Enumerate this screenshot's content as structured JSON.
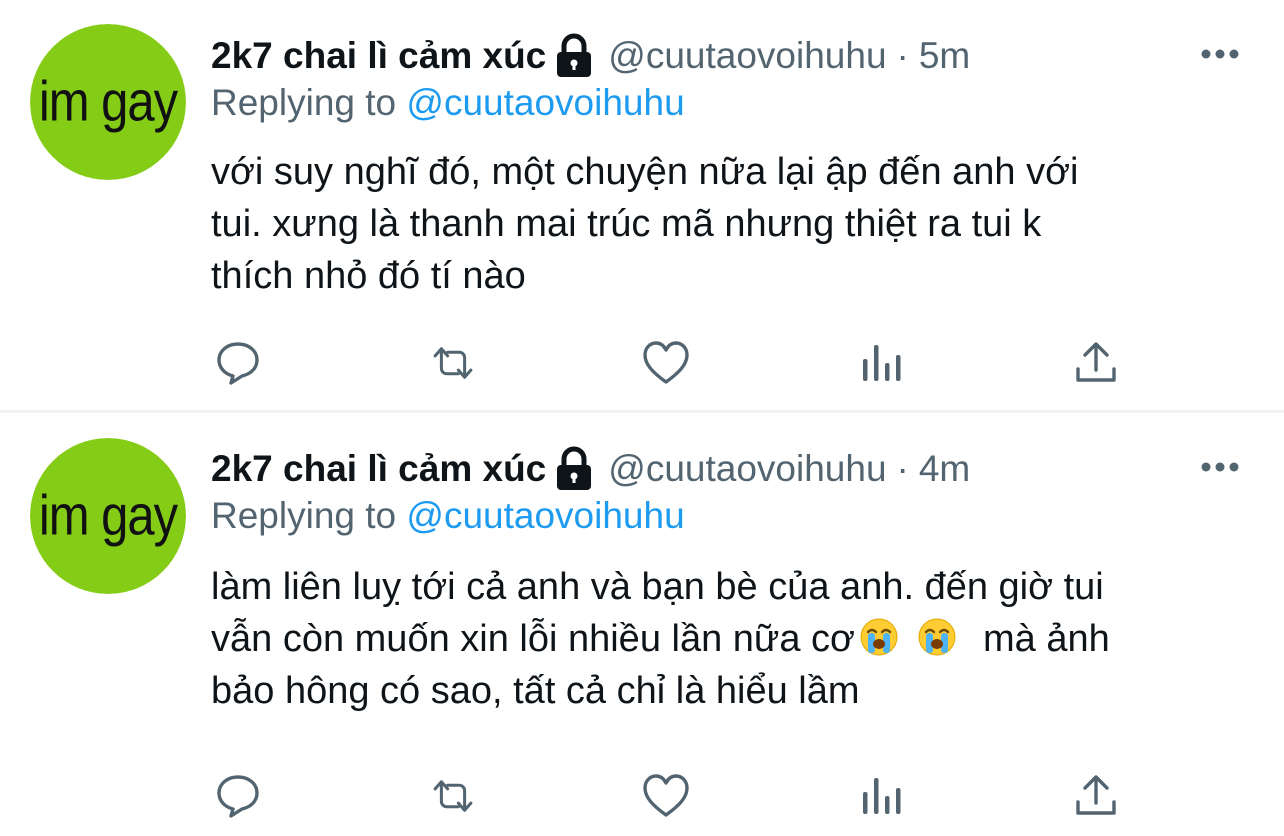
{
  "tweets": [
    {
      "avatar_text": "im gay",
      "display_name": "2k7 chai lì cảm xúc",
      "handle": "@cuutaovoihuhu",
      "separator": "·",
      "time": "5m",
      "replying_prefix": "Replying to",
      "replying_to": "@cuutaovoihuhu",
      "body_lines": [
        "với suy nghĩ đó, một chuyện nữa lại ập đến anh với",
        "tui. xưng là thanh mai trúc mã nhưng thiệt ra tui k",
        "thích nhỏ đó tí nào"
      ]
    },
    {
      "avatar_text": "im gay",
      "display_name": "2k7 chai lì cảm xúc",
      "handle": "@cuutaovoihuhu",
      "separator": "·",
      "time": "4m",
      "replying_prefix": "Replying to",
      "replying_to": "@cuutaovoihuhu",
      "body_lines": [
        "làm liên luỵ tới cả anh và bạn bè của anh. đến giờ tui",
        "vẫn còn muốn xin lỗi nhiều lần nữa cơ",
        "mà ảnh",
        "bảo hông có sao, tất cả chỉ là hiểu lầm"
      ],
      "emojis": [
        "loudly-crying-face-icon",
        "loudly-crying-face-icon"
      ]
    }
  ],
  "action_icons": [
    "reply-icon",
    "retweet-icon",
    "like-icon",
    "analytics-icon",
    "share-icon"
  ],
  "colors": {
    "avatar_bg": "#84cc16",
    "text_primary": "#0f1419",
    "text_secondary": "#536471",
    "link": "#1d9bf0",
    "divider": "#eff3f4"
  }
}
